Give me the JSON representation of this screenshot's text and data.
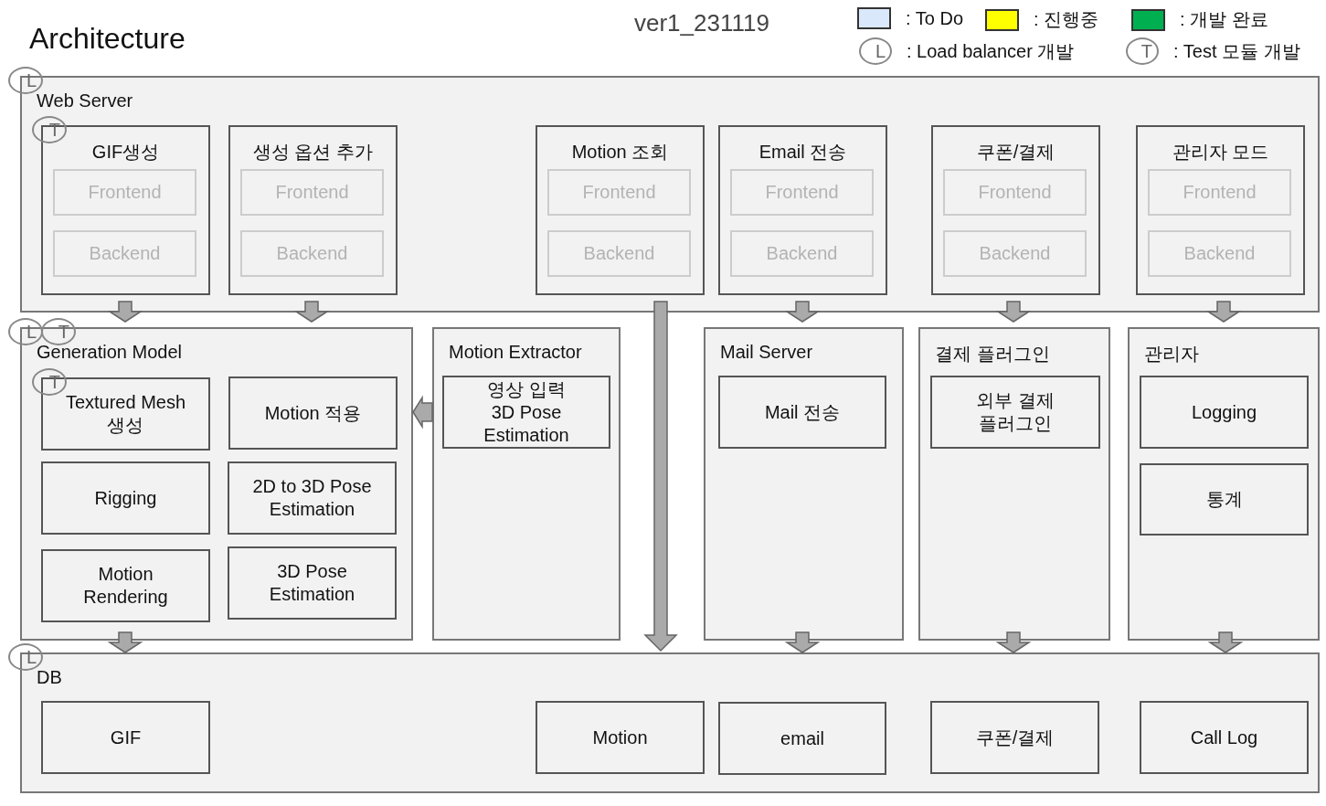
{
  "title": "Architecture",
  "version": "ver1_231119",
  "legend": {
    "colors": [
      {
        "color": "#dae8fc",
        "label": ": To Do"
      },
      {
        "color": "#ffff00",
        "label": ": 진행중"
      },
      {
        "color": "#00b050",
        "label": ": 개발 완료"
      }
    ],
    "markers": [
      {
        "badge": "L",
        "label": ": Load balancer 개발"
      },
      {
        "badge": "T",
        "label": ": Test 모듈 개발"
      }
    ]
  },
  "layers": [
    {
      "title": "Web Server",
      "badges": [
        "L"
      ],
      "items": [
        {
          "label": "GIF생성",
          "badges": [
            "T"
          ],
          "parts": [
            "Frontend",
            "Backend"
          ]
        },
        {
          "label": "생성 옵션 추가",
          "parts": [
            "Frontend",
            "Backend"
          ]
        },
        {
          "label": "Motion 조회",
          "parts": [
            "Frontend",
            "Backend"
          ]
        },
        {
          "label": "Email 전송",
          "parts": [
            "Frontend",
            "Backend"
          ]
        },
        {
          "label": "쿠폰/결제",
          "parts": [
            "Frontend",
            "Backend"
          ]
        },
        {
          "label": "관리자 모드",
          "parts": [
            "Frontend",
            "Backend"
          ]
        }
      ]
    },
    {
      "title": "Generation Model",
      "badges": [
        "L",
        "T"
      ],
      "items": [
        {
          "label": "Textured Mesh\n생성",
          "badges": [
            "T"
          ]
        },
        {
          "label": "Motion 적용"
        },
        {
          "label": "Rigging"
        },
        {
          "label": "2D to 3D Pose\nEstimation"
        },
        {
          "label": "Motion\nRendering"
        },
        {
          "label": "3D Pose\nEstimation"
        }
      ]
    },
    {
      "title": "Motion Extractor",
      "items": [
        {
          "label": "영상 입력\n3D Pose\nEstimation"
        }
      ]
    },
    {
      "title": "Mail Server",
      "items": [
        {
          "label": "Mail 전송"
        }
      ]
    },
    {
      "title": "결제 플러그인",
      "items": [
        {
          "label": "외부 결제\n플러그인"
        }
      ]
    },
    {
      "title": "관리자",
      "items": [
        {
          "label": "Logging"
        },
        {
          "label": "통계"
        }
      ]
    },
    {
      "title": "DB",
      "badges": [
        "L"
      ],
      "items": [
        {
          "label": "GIF"
        },
        {
          "label": "Motion"
        },
        {
          "label": "email"
        },
        {
          "label": "쿠폰/결제"
        },
        {
          "label": "Call Log"
        }
      ]
    }
  ]
}
